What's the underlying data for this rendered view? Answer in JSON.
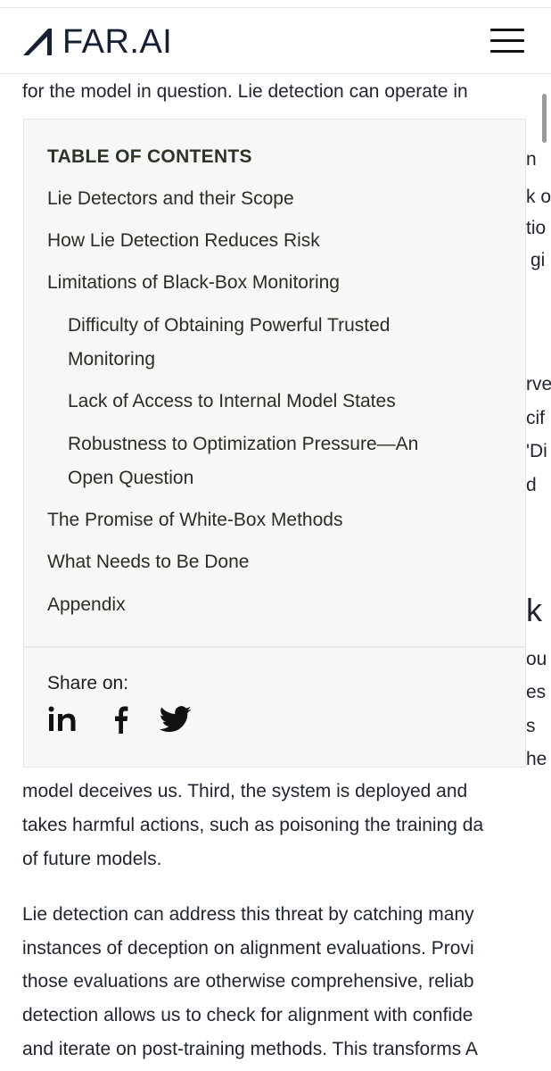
{
  "header": {
    "logo_text": "FAR.AI"
  },
  "article_top_line": "for the model in question. Lie detection can operate in",
  "article_fragments": {
    "frag1": "n",
    "frag2": "k o",
    "frag3": "tio",
    "frag4": "gi",
    "frag5": "rve",
    "frag6": "cif",
    "frag7": "'Di",
    "frag8": "d",
    "frag9": "ou",
    "frag10": "es",
    "frag11": "s",
    "frag12": "he",
    "heading_frag": "k"
  },
  "article_bottom": {
    "p1_l1": "model deceives us. Third, the system is deployed and",
    "p1_l2": "takes harmful actions, such as poisoning the training da",
    "p1_l3": "of future models.",
    "p2_l1": "Lie detection can address this threat by catching many",
    "p2_l2": "instances of deception on alignment evaluations. Provi",
    "p2_l3": "those evaluations are otherwise comprehensive, reliab",
    "p2_l4": "detection allows us to check for alignment with confide",
    "p2_l5": "and iterate on post-training methods. This transforms A"
  },
  "toc": {
    "title": "TABLE OF CONTENTS",
    "items": [
      {
        "label": "Lie Detectors and their Scope"
      },
      {
        "label": "How Lie Detection Reduces Risk"
      },
      {
        "label": "Limitations of Black-Box Monitoring"
      },
      {
        "label_l1": "Difficulty of Obtaining Powerful Trusted",
        "label_l2": "Monitoring"
      },
      {
        "label": "Lack of Access to Internal Model States"
      },
      {
        "label_l1": "Robustness to Optimization Pressure—An",
        "label_l2": "Open Question"
      },
      {
        "label": "The Promise of White-Box Methods"
      },
      {
        "label": "What Needs to Be Done"
      },
      {
        "label": "Appendix"
      }
    ]
  },
  "share": {
    "label": "Share on:",
    "icons": [
      "linkedin-icon",
      "facebook-icon",
      "twitter-icon"
    ]
  },
  "colors": {
    "brand": "#152035",
    "toc_bg": "#f7f7f7",
    "text": "#1f2430"
  }
}
